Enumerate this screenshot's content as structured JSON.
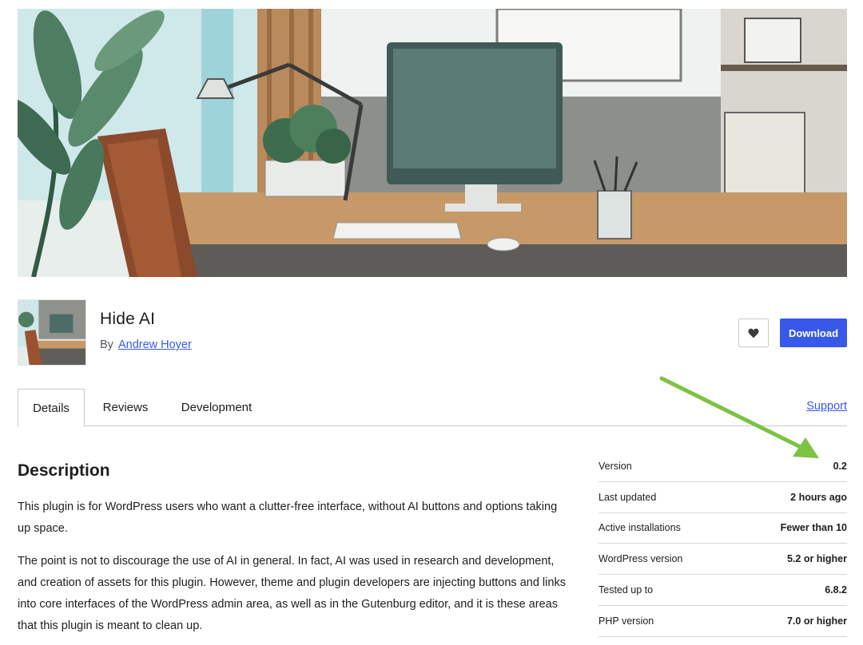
{
  "plugin": {
    "name": "Hide AI",
    "author_prefix": "By",
    "author": "Andrew Hoyer",
    "download_label": "Download",
    "favorite_icon": "heart-icon"
  },
  "tabs": [
    {
      "label": "Details",
      "active": true
    },
    {
      "label": "Reviews",
      "active": false
    },
    {
      "label": "Development",
      "active": false
    }
  ],
  "support_label": "Support",
  "description": {
    "heading": "Description",
    "paragraphs": [
      "This plugin is for WordPress users who want a clutter-free interface, without AI buttons and options taking up space.",
      "The point is not to discourage the use of AI in general. In fact, AI was used in research and development, and creation of assets for this plugin. However, theme and plugin developers are injecting buttons and links into core interfaces of the WordPress admin area, as well as in the Gutenburg editor, and it is these areas that this plugin is meant to clean up."
    ]
  },
  "meta": [
    {
      "label": "Version",
      "value": "0.2"
    },
    {
      "label": "Last updated",
      "value": "2 hours ago"
    },
    {
      "label": "Active installations",
      "value": "Fewer than 10"
    },
    {
      "label": "WordPress version",
      "value": "5.2 or higher"
    },
    {
      "label": "Tested up to",
      "value": "6.8.2"
    },
    {
      "label": "PHP version",
      "value": "7.0 or higher"
    }
  ],
  "colors": {
    "accent": "#3858e9",
    "annotation_arrow": "#7dc243"
  }
}
